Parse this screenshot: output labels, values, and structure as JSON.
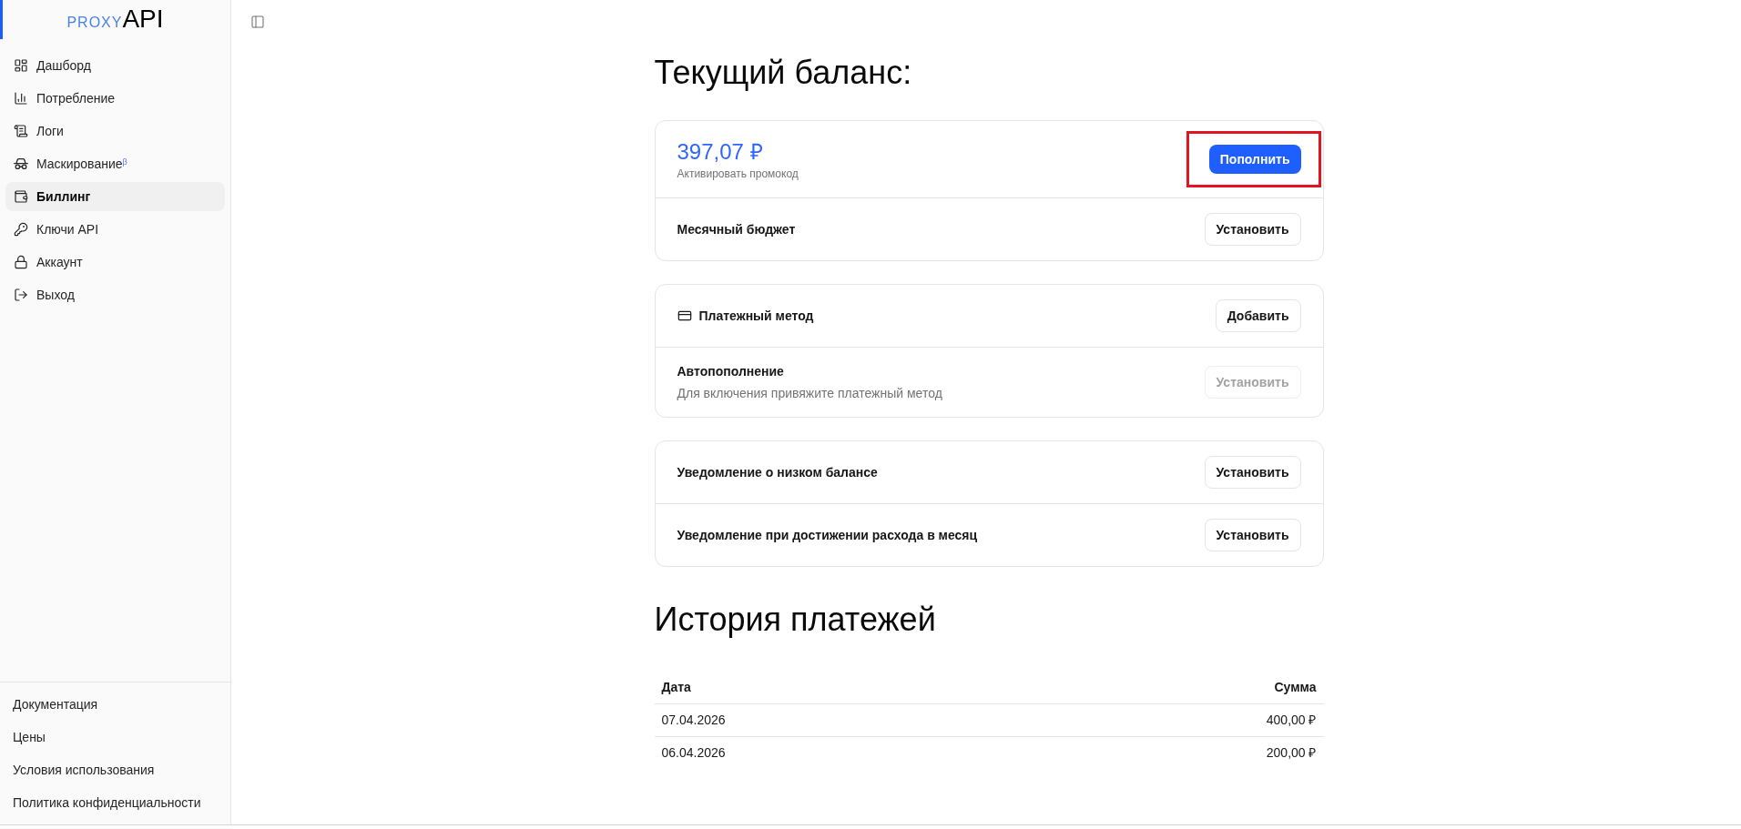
{
  "sidebar": {
    "logo": {
      "prefix": "PROXY",
      "suffix": "API"
    },
    "items": [
      {
        "label": "Дашборд",
        "selected": false
      },
      {
        "label": "Потребление",
        "selected": false
      },
      {
        "label": "Логи",
        "selected": false
      },
      {
        "label": "Маскирование$^{β}$",
        "selected": false
      },
      {
        "label": "Биллинг",
        "selected": true
      },
      {
        "label": "Ключи API",
        "selected": false
      },
      {
        "label": "Аккаунт",
        "selected": false
      },
      {
        "label": "Выход",
        "selected": false
      }
    ],
    "footer_links": [
      "Документация",
      "Цены",
      "Условия использования",
      "Политика конфиденциальности"
    ]
  },
  "balance": {
    "title": "Текущий баланс:",
    "cards": [
      {
        "rows": [
          {
            "kind": "balance",
            "amount": "397,07 ₽",
            "promo_link": "Активировать промокод",
            "button": {
              "label": "Пополнить",
              "kind": "primary",
              "disabled": false,
              "highlighted": true
            }
          },
          {
            "kind": "setting",
            "label": "Месячный бюджет",
            "button": {
              "label": "Установить",
              "kind": "outline",
              "disabled": false,
              "highlighted": false
            }
          }
        ]
      },
      {
        "rows": [
          {
            "kind": "method",
            "label": "Платежный метод",
            "button": {
              "label": "Добавить",
              "kind": "outline",
              "disabled": false,
              "highlighted": false
            }
          },
          {
            "kind": "setting",
            "label": "Автопополнение",
            "description": "Для включения привяжите платежный метод",
            "button": {
              "label": "Установить",
              "kind": "outline",
              "disabled": true,
              "highlighted": false
            }
          }
        ]
      },
      {
        "rows": [
          {
            "kind": "setting",
            "label": "Уведомление о низком балансе",
            "button": {
              "label": "Установить",
              "kind": "outline",
              "disabled": false,
              "highlighted": false
            }
          },
          {
            "kind": "setting",
            "label": "Уведомление при достижении расхода в месяц",
            "button": {
              "label": "Установить",
              "kind": "outline",
              "disabled": false,
              "highlighted": false
            }
          }
        ]
      }
    ]
  },
  "history": {
    "title": "История платежей",
    "columns": [
      "Дата",
      "Сумма"
    ],
    "rows": [
      [
        "07.04.2026",
        "400,00 ₽"
      ],
      [
        "06.04.2026",
        "200,00 ₽"
      ]
    ]
  }
}
